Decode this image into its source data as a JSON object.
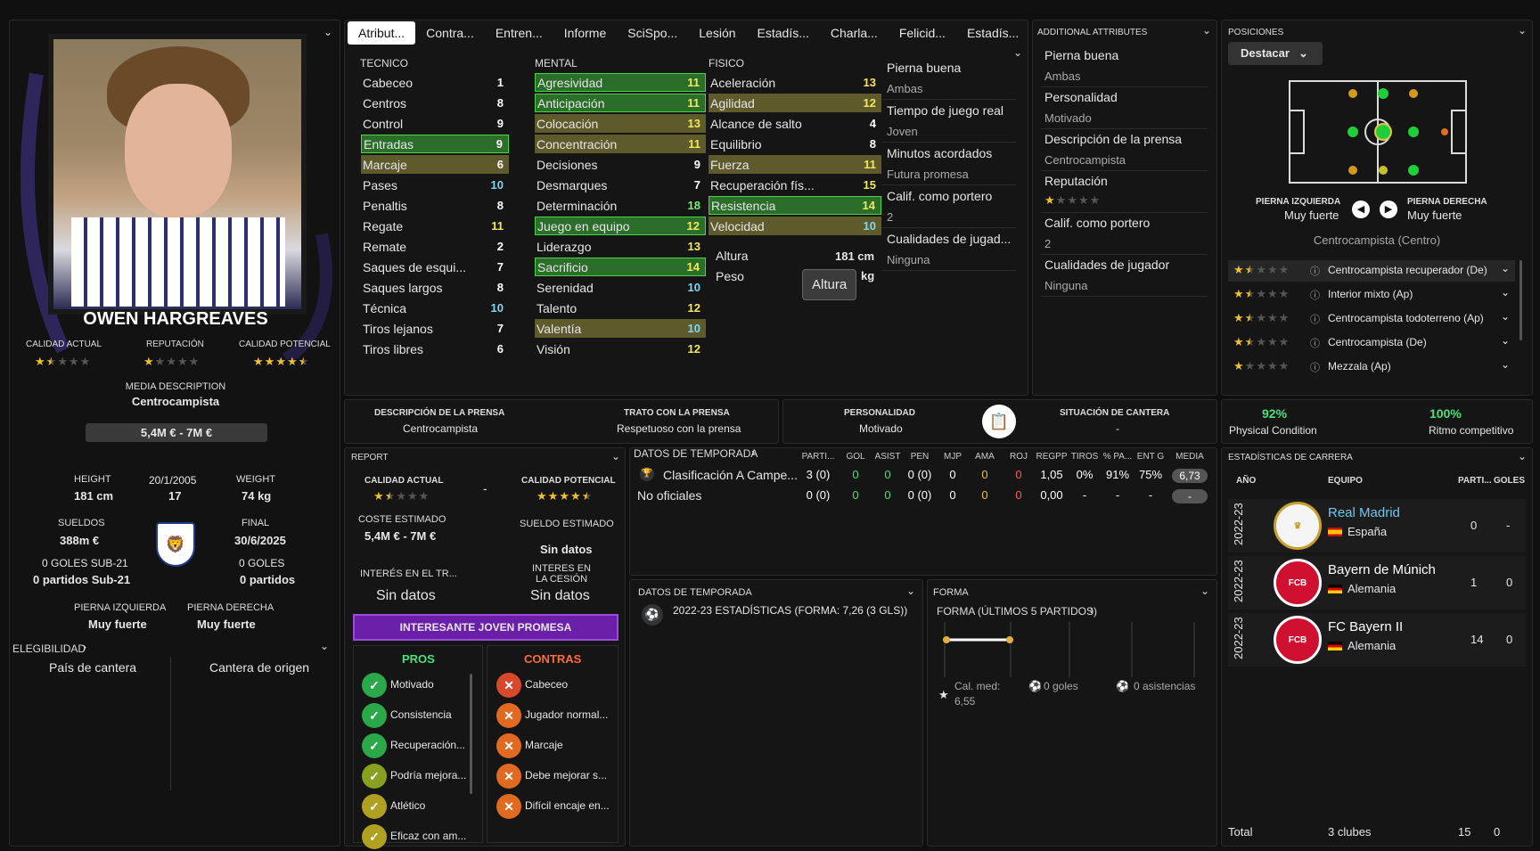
{
  "player": {
    "name": "OWEN HARGREAVES",
    "media_description_label": "MEDIA DESCRIPTION",
    "media_description": "Centrocampista",
    "value_range": "5,4M € - 7M €",
    "ca_label": "CALIDAD ACTUAL",
    "rep_label": "REPUTACIÓN",
    "pa_label": "CALIDAD POTENCIAL",
    "ca_stars": 1.5,
    "rep_stars": 1,
    "pa_stars": 4.5,
    "height_label": "HEIGHT",
    "height": "181 cm",
    "dob": "20/1/2005",
    "age": "17",
    "weight_label": "WEIGHT",
    "weight": "74 kg",
    "wage_label": "SUELDOS",
    "wage": "388m €",
    "final_label": "FINAL",
    "final": "30/6/2025",
    "goals_u21_label": "0 GOLES SUB-21",
    "matches_u21": "0 partidos Sub-21",
    "goals_label": "0 GOLES",
    "matches": "0 partidos",
    "left_foot_label": "PIERNA IZQUIERDA",
    "left_foot": "Muy fuerte",
    "right_foot_label": "PIERNA DERECHA",
    "right_foot": "Muy fuerte",
    "eligibility_label": "ELEGIBILIDAD",
    "country_label": "País de cantera",
    "club_label": "Cantera de origen"
  },
  "tabs": [
    "Atribut...",
    "Contra...",
    "Entren...",
    "Informe",
    "SciSpo...",
    "Lesión",
    "Estadís...",
    "Charla...",
    "Felicid...",
    "Estadís..."
  ],
  "attributes": {
    "tecnico_label": "TECNICO",
    "mental_label": "MENTAL",
    "fisico_label": "FISICO",
    "tecnico": [
      [
        "Cabeceo",
        "1",
        "c-w",
        ""
      ],
      [
        "Centros",
        "8",
        "c-w",
        ""
      ],
      [
        "Control",
        "9",
        "c-w",
        ""
      ],
      [
        "Entradas",
        "9",
        "c-w",
        "hl-g"
      ],
      [
        "Marcaje",
        "6",
        "c-w",
        "hl-o"
      ],
      [
        "Pases",
        "10",
        "c-c",
        ""
      ],
      [
        "Penaltis",
        "8",
        "c-w",
        ""
      ],
      [
        "Regate",
        "11",
        "c-y",
        ""
      ],
      [
        "Remate",
        "2",
        "c-w",
        ""
      ],
      [
        "Saques de esqui...",
        "7",
        "c-w",
        ""
      ],
      [
        "Saques largos",
        "8",
        "c-w",
        ""
      ],
      [
        "Técnica",
        "10",
        "c-c",
        ""
      ],
      [
        "Tiros lejanos",
        "7",
        "c-w",
        ""
      ],
      [
        "Tiros libres",
        "6",
        "c-w",
        ""
      ]
    ],
    "mental": [
      [
        "Agresividad",
        "11",
        "c-y",
        "hl-g"
      ],
      [
        "Anticipación",
        "11",
        "c-y",
        "hl-g"
      ],
      [
        "Colocación",
        "13",
        "c-y",
        "hl-o"
      ],
      [
        "Concentración",
        "11",
        "c-y",
        "hl-o"
      ],
      [
        "Decisiones",
        "9",
        "c-w",
        ""
      ],
      [
        "Desmarques",
        "7",
        "c-w",
        ""
      ],
      [
        "Determinación",
        "18",
        "c-g",
        ""
      ],
      [
        "Juego en equipo",
        "12",
        "c-y",
        "hl-g"
      ],
      [
        "Liderazgo",
        "13",
        "c-y",
        ""
      ],
      [
        "Sacrificio",
        "14",
        "c-y",
        "hl-g"
      ],
      [
        "Serenidad",
        "10",
        "c-c",
        ""
      ],
      [
        "Talento",
        "12",
        "c-y",
        ""
      ],
      [
        "Valentía",
        "10",
        "c-c",
        "hl-o"
      ],
      [
        "Visión",
        "12",
        "c-y",
        ""
      ]
    ],
    "fisico": [
      [
        "Aceleración",
        "13",
        "c-y",
        ""
      ],
      [
        "Agilidad",
        "12",
        "c-y",
        "hl-o"
      ],
      [
        "Alcance de salto",
        "4",
        "c-w",
        ""
      ],
      [
        "Equilibrio",
        "8",
        "c-w",
        ""
      ],
      [
        "Fuerza",
        "11",
        "c-y",
        "hl-o"
      ],
      [
        "Recuperación fís...",
        "15",
        "c-y",
        ""
      ],
      [
        "Resistencia",
        "14",
        "c-y",
        "hl-g"
      ],
      [
        "Velocidad",
        "10",
        "c-c",
        "hl-o"
      ]
    ],
    "altura_label": "Altura",
    "altura": "181 cm",
    "peso_label": "Peso",
    "peso": "kg",
    "tooltip": "Altura"
  },
  "side_info": [
    [
      "Pierna buena",
      "Ambas"
    ],
    [
      "Tiempo de juego real",
      "Joven"
    ],
    [
      "Minutos acordados",
      "Futura promesa"
    ],
    [
      "Calif. como portero",
      "2"
    ],
    [
      "Cualidades de jugad...",
      "Ninguna"
    ]
  ],
  "additional": {
    "title": "ADDITIONAL ATTRIBUTES",
    "items": [
      [
        "Pierna buena",
        "Ambas"
      ],
      [
        "Personalidad",
        "Motivado"
      ],
      [
        "Descripción de la prensa",
        "Centrocampista"
      ],
      [
        "Reputación",
        ""
      ],
      [
        "Calif. como portero",
        "2"
      ],
      [
        "Cualidades de jugador",
        "Ninguna"
      ]
    ]
  },
  "positions": {
    "title": "POSICIONES",
    "button": "Destacar",
    "left_foot_label": "PIERNA IZQUIERDA",
    "left_foot": "Muy fuerte",
    "right_foot_label": "PIERNA DERECHA",
    "right_foot": "Muy fuerte",
    "main_role": "Centrocampista (Centro)",
    "roles": [
      [
        "Centrocampista recuperador (De)",
        1.5
      ],
      [
        "Interior mixto (Ap)",
        1.5
      ],
      [
        "Centrocampista todoterreno (Ap)",
        1.5
      ],
      [
        "Centrocampista (De)",
        1.5
      ],
      [
        "Mezzala (Ap)",
        1
      ]
    ]
  },
  "press": {
    "desc_label": "DESCRIPCIÓN DE LA PRENSA",
    "desc": "Centrocampista",
    "treat_label": "TRATO CON LA PRENSA",
    "treat": "Respetuoso con la prensa",
    "pers_label": "PERSONALIDAD",
    "pers": "Motivado",
    "youth_label": "SITUACIÓN DE CANTERA",
    "youth": "-"
  },
  "condition": {
    "physical": "92%",
    "physical_label": "Physical Condition",
    "ritmo": "100%",
    "ritmo_label": "Ritmo competitivo"
  },
  "report": {
    "title": "REPORT",
    "ca_label": "CALIDAD ACTUAL",
    "pa_label": "CALIDAD POTENCIAL",
    "dash": "-",
    "cost_label": "COSTE ESTIMADO",
    "cost": "5,4M € - 7M €",
    "wage_label": "SUELDO ESTIMADO",
    "wage": "Sin datos",
    "interest_label": "INTERÉS EN EL TR...",
    "interest": "Sin datos",
    "loan_label": "INTERES EN LA CESIÓN",
    "loan": "Sin datos",
    "banner": "INTERESANTE JOVEN PROMESA",
    "pros_label": "PROS",
    "cons_label": "CONTRAS",
    "pros": [
      "Motivado",
      "Consistencia",
      "Recuperación...",
      "Podría mejora...",
      "Atlético",
      "Eficaz con am..."
    ],
    "cons": [
      "Cabeceo",
      "Jugador normal...",
      "Marcaje",
      "Debe mejorar s...",
      "Difícil encaje en..."
    ]
  },
  "season": {
    "title": "DATOS DE TEMPORADA",
    "headers": [
      "PARTI...",
      "GOL",
      "ASIST",
      "PEN",
      "MJP",
      "AMA",
      "ROJ",
      "REGPP",
      "TIROS",
      "% PA...",
      "ENT G",
      "MEDIA"
    ],
    "rows": [
      [
        "Clasificación A Campe...",
        "3 (0)",
        "0",
        "0",
        "0 (0)",
        "0",
        "0",
        "0",
        "1,05",
        "0%",
        "91%",
        "75%",
        "6,73"
      ],
      [
        "No oficiales",
        "0 (0)",
        "0",
        "0",
        "0 (0)",
        "0",
        "0",
        "0",
        "0,00",
        "-",
        "-",
        "-",
        "-"
      ]
    ]
  },
  "season2": {
    "title": "DATOS DE TEMPORADA",
    "line": "2022-23 ESTADÍSTICAS (FORMA: 7,26 (3 GLS))"
  },
  "form": {
    "title": "FORMA",
    "subtitle": "FORMA (ÚLTIMOS 5 PARTIDOS)",
    "avg_label": "Cal. med:",
    "avg": "6,55",
    "goals": "0 goles",
    "assists": "0 asistencias"
  },
  "career": {
    "title": "ESTADÍSTICAS DE CARRERA",
    "h_year": "AÑO",
    "h_team": "EQUIPO",
    "h_apps": "PARTI...",
    "h_goals": "GOLES",
    "rows": [
      [
        "2022-23",
        "Real Madrid",
        "España",
        "0",
        "-"
      ],
      [
        "2022-23",
        "Bayern de Múnich",
        "Alemania",
        "1",
        "0"
      ],
      [
        "2022-23",
        "FC Bayern II",
        "Alemania",
        "14",
        "0"
      ]
    ],
    "total_label": "Total",
    "total_clubs": "3 clubes",
    "total_apps": "15",
    "total_goals": "0"
  },
  "colors": {
    "green": "#2a6e2a",
    "olive": "#5e5a2c",
    "purple": "#6a1fa8",
    "gold": "#f0c030"
  }
}
